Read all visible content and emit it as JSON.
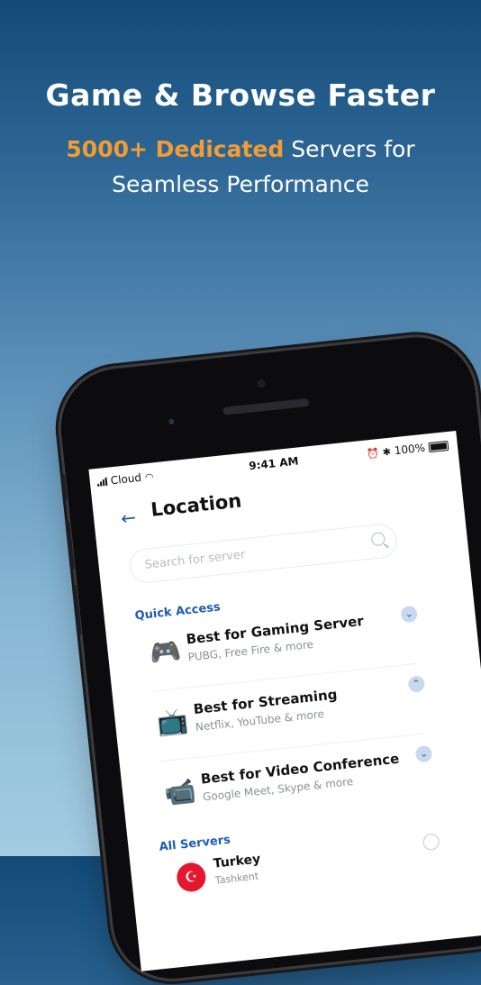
{
  "hero": {
    "headline": "Game & Browse Faster",
    "sub_highlight": "5000+ Dedicated",
    "sub_rest_1": " Servers for",
    "sub_rest_2": "Seamless Performance",
    "accent_color": "#f29c33"
  },
  "status_bar": {
    "carrier": "Cloud",
    "time": "9:41 AM",
    "battery": "100%"
  },
  "screen": {
    "title": "Location",
    "search_placeholder": "Search for server",
    "quick_access_label": "Quick Access",
    "quick_access": [
      {
        "title": "Best for Gaming Server",
        "subtitle": "PUBG, Free Fire & more",
        "icon": "gamepad-icon",
        "chevron": "down"
      },
      {
        "title": "Best for Streaming",
        "subtitle": "Netflix, YouTube & more",
        "icon": "tv-icon",
        "chevron": "up"
      },
      {
        "title": "Best for Video Conference",
        "subtitle": "Google Meet, Skype & more",
        "icon": "video-camera-icon",
        "chevron": "down"
      }
    ],
    "all_servers_label": "All Servers",
    "servers": [
      {
        "country": "Turkey",
        "city": "Tashkent",
        "flag_icon": "turkey-flag-icon"
      }
    ]
  },
  "colors": {
    "brand_blue": "#1c5bb5",
    "background_top": "#124a78",
    "background_bottom": "#a3cce2"
  }
}
